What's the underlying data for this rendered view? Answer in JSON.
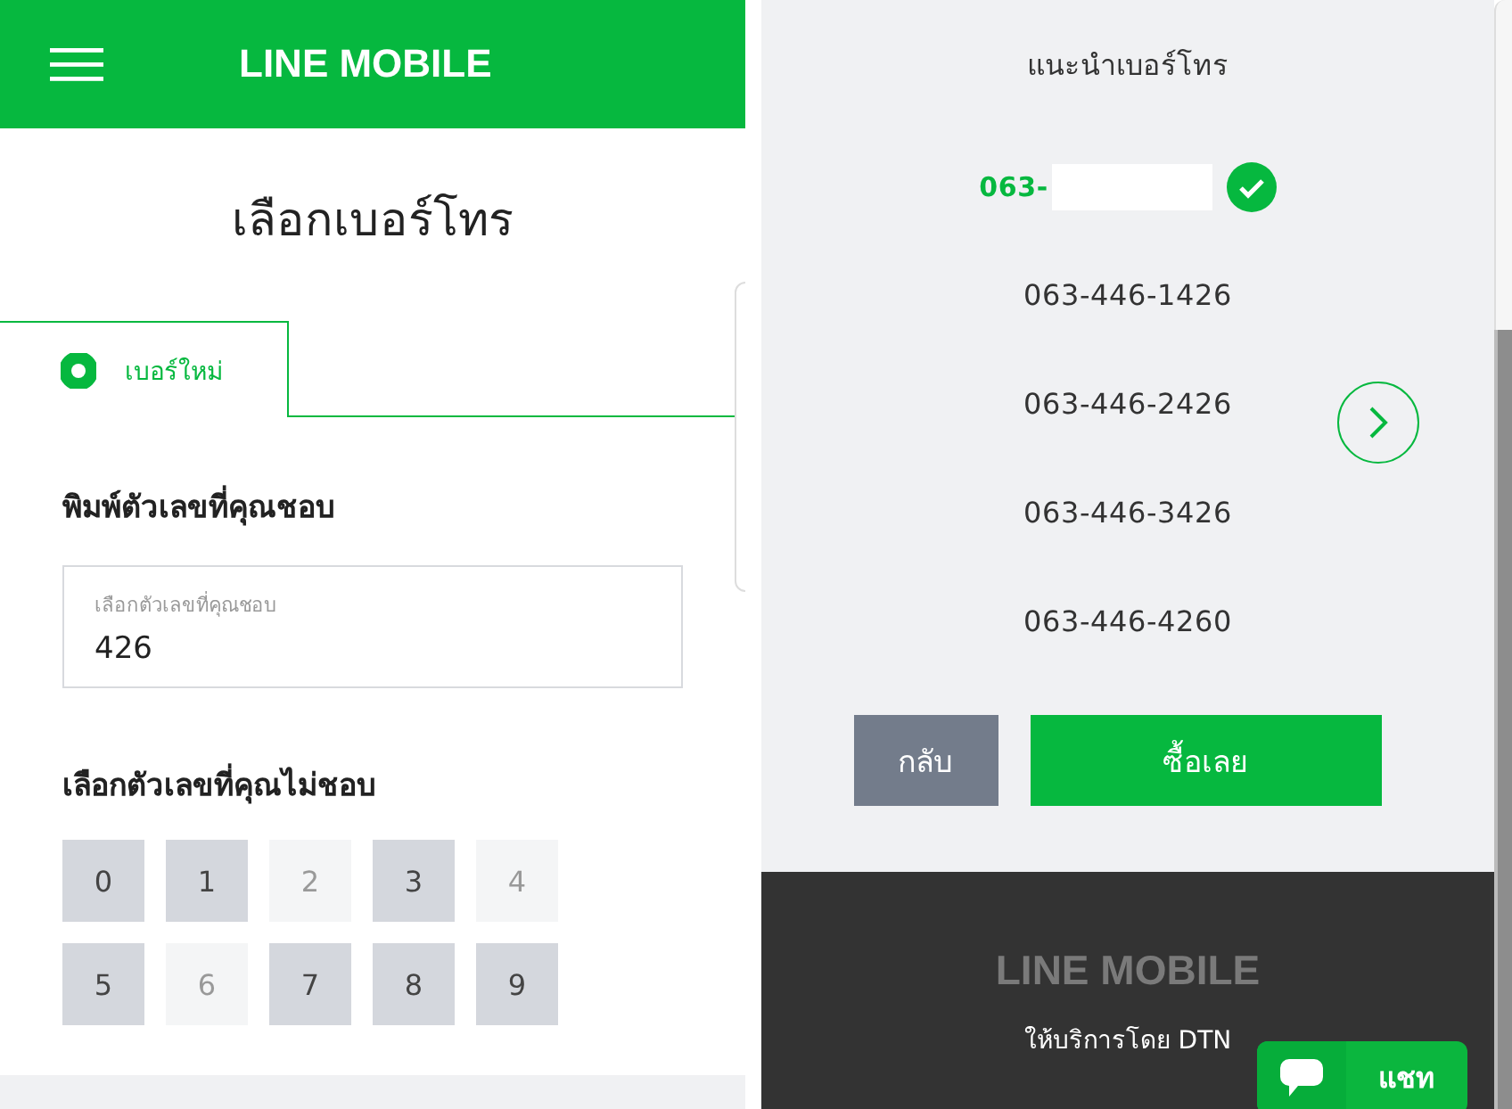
{
  "left": {
    "header": {
      "brand": "LINE MOBILE"
    },
    "page_title": "เลือกเบอร์โทร",
    "tabs": [
      {
        "label": "เบอร์ใหม่",
        "selected": true
      }
    ],
    "like_heading": "พิมพ์ตัวเลขที่คุณชอบ",
    "like_field": {
      "label": "เลือกตัวเลขที่คุณชอบ",
      "value": "426"
    },
    "dislike_heading": "เลือกตัวเลขที่คุณไม่ชอบ",
    "digits": [
      {
        "label": "0",
        "disabled": false
      },
      {
        "label": "1",
        "disabled": false
      },
      {
        "label": "2",
        "disabled": true
      },
      {
        "label": "3",
        "disabled": false
      },
      {
        "label": "4",
        "disabled": true
      },
      {
        "label": "5",
        "disabled": false
      },
      {
        "label": "6",
        "disabled": true
      },
      {
        "label": "7",
        "disabled": false
      },
      {
        "label": "8",
        "disabled": false
      },
      {
        "label": "9",
        "disabled": false
      }
    ]
  },
  "right": {
    "title": "แนะนำเบอร์โทร",
    "numbers": [
      {
        "text": "063-",
        "selected": true
      },
      {
        "text": "063-446-1426",
        "selected": false
      },
      {
        "text": "063-446-2426",
        "selected": false
      },
      {
        "text": "063-446-3426",
        "selected": false
      },
      {
        "text": "063-446-4260",
        "selected": false
      }
    ],
    "buttons": [
      {
        "kind": "back",
        "label": "กลับ"
      },
      {
        "kind": "buy",
        "label": "ซื้อเลย"
      }
    ],
    "footer": {
      "brand": "LINE MOBILE",
      "provider": "ให้บริการโดย DTN"
    },
    "chat_button": {
      "label": "แชท"
    }
  }
}
